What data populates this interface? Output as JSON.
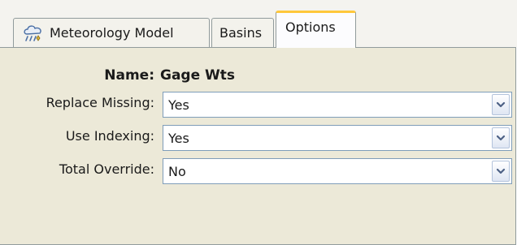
{
  "tabs": [
    {
      "label": "Meteorology Model",
      "icon": "meteorology-model-icon",
      "active": false
    },
    {
      "label": "Basins",
      "active": false
    },
    {
      "label": "Options",
      "active": true
    }
  ],
  "form": {
    "name_label": "Name:",
    "name_value": "Gage Wts",
    "fields": [
      {
        "label": "Replace Missing:",
        "value": "Yes"
      },
      {
        "label": "Use Indexing:",
        "value": "Yes"
      },
      {
        "label": "Total Override:",
        "value": "No"
      }
    ]
  },
  "colors": {
    "panel_background": "#ece9d8",
    "active_tab_highlight": "#ffc83c",
    "combo_border": "#7f9db9"
  }
}
